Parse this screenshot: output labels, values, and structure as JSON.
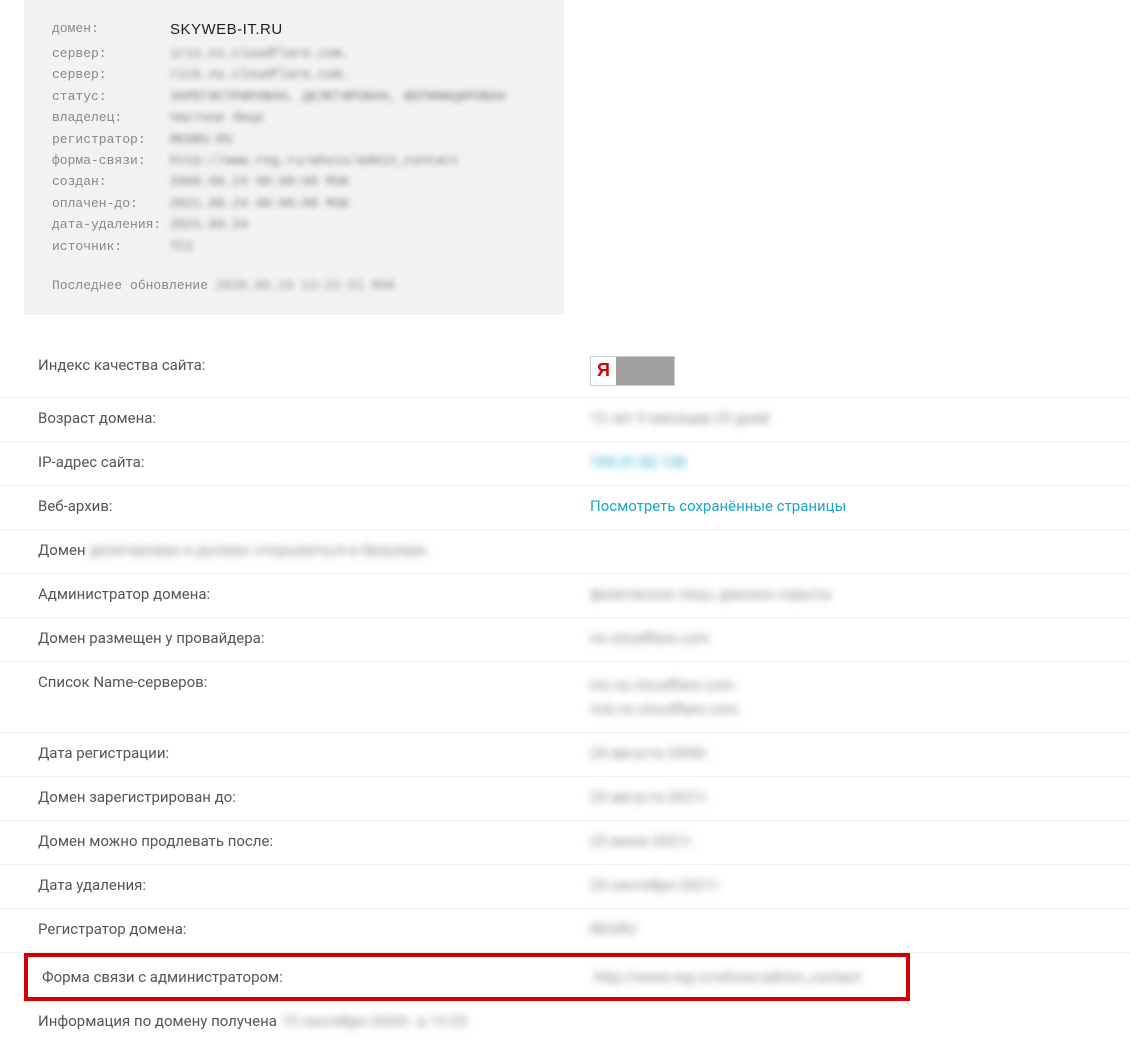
{
  "whois": {
    "labels": {
      "domain": "домен:",
      "server1": "сервер:",
      "server2": "сервер:",
      "status": "статус:",
      "owner": "владелец:",
      "registrar": "регистратор:",
      "contact_form": "форма-связи:",
      "created": "создан:",
      "paid_till": "оплачен-до:",
      "delete_date": "дата-удаления:",
      "source": "источник:"
    },
    "values": {
      "domain": "SKYWEB-IT.RU",
      "server1": "iris.ns.cloudflare.com.",
      "server2": "rick.ns.cloudflare.com.",
      "status": "ЗАРЕГИСТРИРОВАН, ДЕЛЕГИРОВАН, ВЕРИФИЦИРОВАН",
      "owner": "Частное Лицо",
      "registrar": "REGRU-RU",
      "contact_form": "http://www.reg.ru/whois/admin_contact",
      "created": "2008.08.24 00:00:00 MSK",
      "paid_till": "2021.08.24 00:00:00 MSK",
      "delete_date": "2021.09.24",
      "source": "TCI"
    },
    "last_update_label": "Последнее обновление",
    "last_update_value": "2020.09.15 12:21:51 MSK"
  },
  "info": {
    "quality_label": "Индекс качества сайта:",
    "yandex_letter": "Я",
    "age_label": "Возраст домена:",
    "age_value": "12 лет 0 месяцев 25 дней",
    "ip_label": "IP-адрес сайта:",
    "ip_value": "104.31.82.136",
    "webarchive_label": "Веб-архив:",
    "webarchive_value": "Посмотреть сохранённые страницы",
    "domain_prefix": "Домен",
    "domain_status_text": "делегирован и должен открываться в браузере.",
    "admin_label": "Администратор домена:",
    "admin_value": "физическое лицо, данные скрыты",
    "provider_label": "Домен размещен у провайдера:",
    "provider_value": "ns.cloudflare.com",
    "ns_label": "Список Name-серверов:",
    "ns_value1": "iris.ns.cloudflare.com.",
    "ns_value2": "rick.ns.cloudflare.com.",
    "regdate_label": "Дата регистрации:",
    "regdate_value": "24 августа 2008г.",
    "regtill_label": "Домен зарегистрирован до:",
    "regtill_value": "24 августа 2021г.",
    "renew_label": "Домен можно продлевать после:",
    "renew_value": "25 июня 2021г.",
    "delete_label": "Дата удаления:",
    "delete_value": "24 сентября 2021г.",
    "registrar_label": "Регистратор домена:",
    "registrar_value": "REGRU",
    "contact_label": "Форма связи с администратором:",
    "contact_value": "http://www.reg.ru/whois/admin_contact",
    "obtained_prefix": "Информация по домену получена",
    "obtained_value": "15 сентября 2020г. в 12:25"
  }
}
